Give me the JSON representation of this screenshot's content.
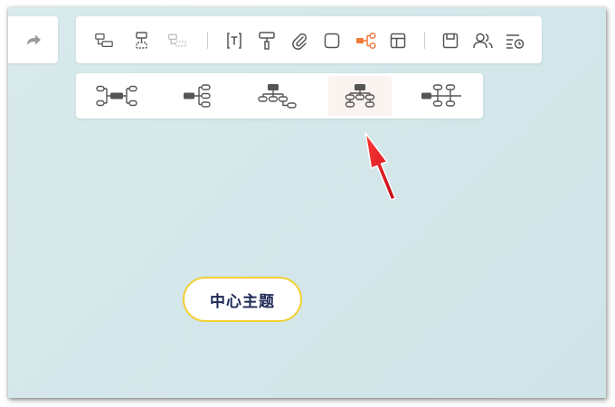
{
  "colors": {
    "canvas_bg": "#d6e8eb",
    "icon_gray": "#555555",
    "icon_light": "#b8b8b8",
    "accent_orange": "#f07a3a",
    "topic_border": "#f2cf32",
    "topic_text": "#1e2a55",
    "arrow_red": "#e8121c"
  },
  "undo_panel": {
    "redo_icon": "redo-arrow-icon"
  },
  "toolbar": {
    "items": [
      {
        "icon": "insert-subtopic-icon"
      },
      {
        "icon": "insert-sibling-topic-icon"
      },
      {
        "icon": "insert-parent-topic-icon",
        "disabled": true
      },
      {
        "icon": "text-box-icon"
      },
      {
        "icon": "format-painter-icon"
      },
      {
        "icon": "attachment-icon"
      },
      {
        "icon": "shape-square-icon"
      },
      {
        "icon": "structure-layout-icon",
        "active": true
      },
      {
        "icon": "theme-layout-icon"
      },
      {
        "icon": "save-icon"
      },
      {
        "icon": "collaborators-icon"
      },
      {
        "icon": "history-list-icon"
      }
    ]
  },
  "layout_panel": {
    "options": [
      {
        "icon": "mind-map-both-sides-icon"
      },
      {
        "icon": "logic-chart-right-icon"
      },
      {
        "icon": "org-chart-down-right-icon"
      },
      {
        "icon": "org-chart-down-icon",
        "active": true
      },
      {
        "icon": "timeline-horizontal-icon"
      }
    ]
  },
  "central_topic": {
    "label": "中心主题"
  }
}
